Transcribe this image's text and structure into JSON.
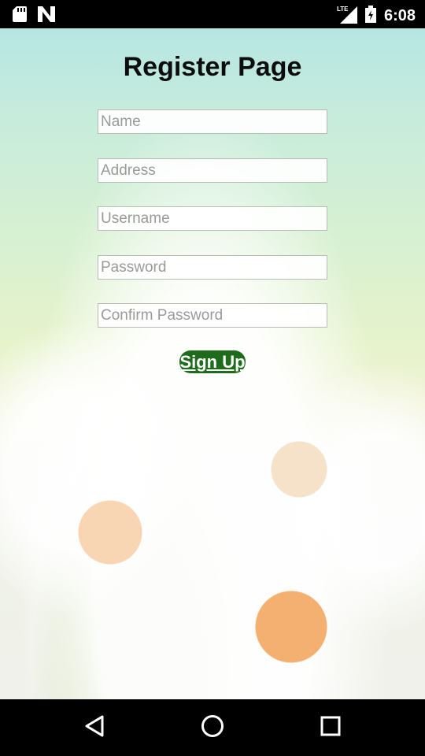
{
  "status_bar": {
    "time": "6:08",
    "network_type": "LTE",
    "icons": [
      "sd-card-icon",
      "n-notification-icon",
      "lte-signal-icon",
      "battery-icon"
    ]
  },
  "page": {
    "title": "Register Page"
  },
  "form": {
    "name": {
      "placeholder": "Name",
      "value": ""
    },
    "address": {
      "placeholder": "Address",
      "value": ""
    },
    "username": {
      "placeholder": "Username",
      "value": ""
    },
    "password": {
      "placeholder": "Password",
      "value": ""
    },
    "confirm_password": {
      "placeholder": "Confirm Password",
      "value": ""
    },
    "signup_label": "Sign Up"
  },
  "colors": {
    "signup_button": "#1e6b1c",
    "title_text": "#0d0d0d"
  },
  "nav_bar": {
    "icons": [
      "back-icon",
      "home-icon",
      "recents-icon"
    ]
  }
}
